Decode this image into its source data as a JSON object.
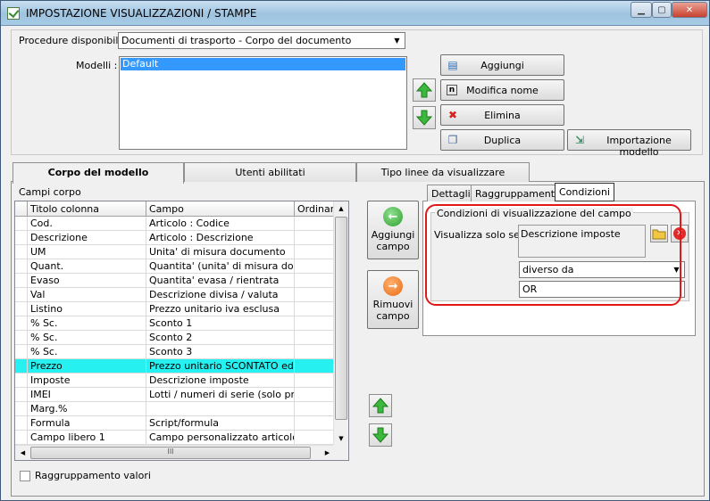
{
  "window": {
    "title": "IMPOSTAZIONE VISUALIZZAZIONI / STAMPE",
    "controls": [
      "minimize-icon",
      "maximize-icon",
      "close-icon"
    ]
  },
  "top": {
    "procedure_label": "Procedure disponibili :",
    "procedure_value": "Documenti di trasporto - Corpo del documento",
    "modelli_label": "Modelli :",
    "modelli": [
      "Default"
    ],
    "selected_model": "Default",
    "buttons": {
      "aggiungi": "Aggiungi",
      "modifica_nome": "Modifica nome",
      "elimina": "Elimina",
      "duplica": "Duplica",
      "importazione": "Importazione modello"
    }
  },
  "tabs": [
    {
      "label": "Corpo del modello",
      "active": true
    },
    {
      "label": "Utenti abilitati",
      "active": false
    },
    {
      "label": "Tipo linee da visualizzare",
      "active": false
    }
  ],
  "campi_corpo": {
    "label": "Campi corpo",
    "columns": [
      "Titolo colonna",
      "Campo",
      "Ordinamen"
    ],
    "rows": [
      {
        "titolo": "Cod.",
        "campo": "Articolo : Codice"
      },
      {
        "titolo": "Descrizione",
        "campo": "Articolo : Descrizione"
      },
      {
        "titolo": "UM",
        "campo": "Unita' di misura documento"
      },
      {
        "titolo": "Quant.",
        "campo": "Quantita' (unita' di misura docum..."
      },
      {
        "titolo": "Evaso",
        "campo": "Quantita' evasa / rientrata"
      },
      {
        "titolo": "Val",
        "campo": "Descrizione divisa / valuta"
      },
      {
        "titolo": "Listino",
        "campo": "Prezzo unitario iva esclusa"
      },
      {
        "titolo": "% Sc.",
        "campo": "Sconto 1"
      },
      {
        "titolo": "% Sc.",
        "campo": "Sconto 2"
      },
      {
        "titolo": "% Sc.",
        "campo": "Sconto 3"
      },
      {
        "titolo": "Prezzo",
        "campo": "Prezzo unitario SCONTATO ed I..."
      },
      {
        "titolo": "Imposte",
        "campo": "Descrizione imposte"
      },
      {
        "titolo": "IMEI",
        "campo": "Lotti / numeri di serie (solo primi ..."
      },
      {
        "titolo": "Marg.%",
        "campo": ""
      },
      {
        "titolo": "Formula",
        "campo": "Script/formula"
      },
      {
        "titolo": "Campo libero 1",
        "campo": "Campo personalizzato articolo (s..."
      }
    ],
    "selected_row_index": 10,
    "selected_color": "#27f0f0",
    "hscroll_grip": "III"
  },
  "middle_buttons": {
    "aggiungi": "Aggiungi campo",
    "rimuovi": "Rimuovi campo"
  },
  "subtabs": [
    {
      "label": "Dettagli",
      "active": false
    },
    {
      "label": "Raggruppamento",
      "active": false
    },
    {
      "label": "Condizioni",
      "active": true
    }
  ],
  "condizioni": {
    "group_title": "Condizioni di visualizzazione del campo",
    "visualizza_label": "Visualizza solo se :",
    "campo_value": "Descrizione imposte",
    "operator_value": "diverso da",
    "compare_value": "OR",
    "highlight_color": "#e01818"
  },
  "footer": {
    "raggruppamento_label": "Raggruppamento valori",
    "raggruppamento_checked": false
  }
}
